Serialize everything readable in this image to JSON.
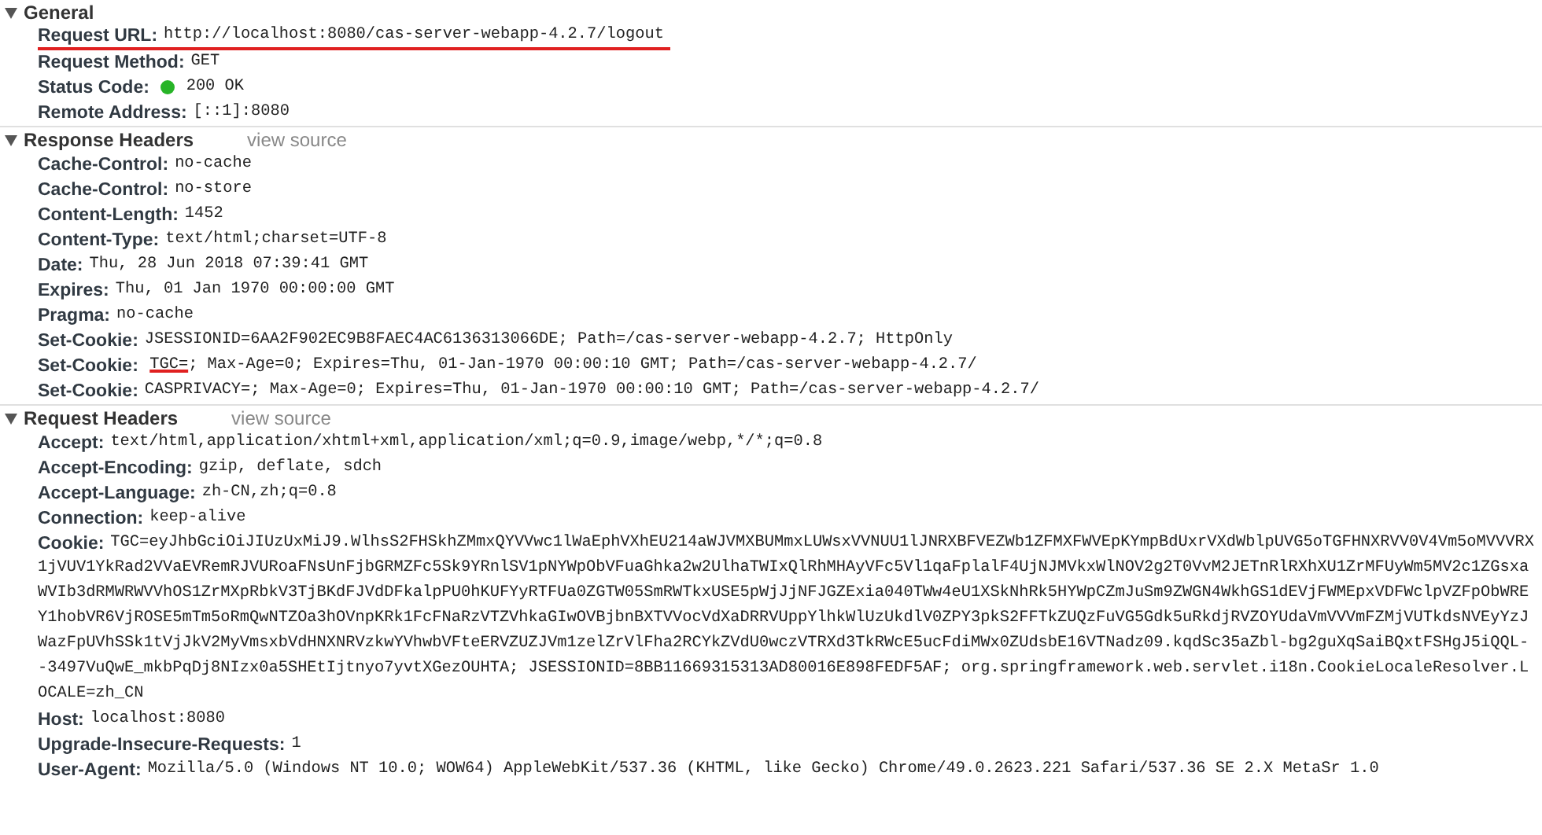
{
  "sections": [
    {
      "title": "General",
      "expanded": true,
      "rows": [
        {
          "key": "Request URL:",
          "value": "http://localhost:8080/cas-server-webapp-4.2.7/logout",
          "underlined": true
        },
        {
          "key": "Request Method:",
          "value": "GET",
          "underlined": false
        },
        {
          "key": "Status Code:",
          "value": "200 OK",
          "color": "#27b427",
          "underlined": false
        },
        {
          "key": "Remote Address:",
          "value": "[::1]:8080",
          "underlined": false
        }
      ]
    },
    {
      "title": "Response Headers",
      "view_source": "view source",
      "expanded": true,
      "rows": [
        {
          "key": "Cache-Control:",
          "value": "no-cache",
          "underlined": false
        },
        {
          "key": "Cache-Control:",
          "value": "no-store",
          "underlined": false
        },
        {
          "key": "Content-Length:",
          "value": "1452",
          "underlined": false
        },
        {
          "key": "Content-Type:",
          "value": "text/html;charset=UTF-8",
          "underlined": false
        },
        {
          "key": "Date:",
          "value": "Thu, 28 Jun 2018 07:39:41 GMT",
          "underlined": false
        },
        {
          "key": "Expires:",
          "value": "Thu, 01 Jan 1970 00:00:00 GMT",
          "underlined": false
        },
        {
          "key": "Pragma:",
          "value": "no-cache",
          "underlined": false
        },
        {
          "key": "Set-Cookie:",
          "value": "JSESSIONID=6AA2F902EC9B8FAEC4AC6136313066DE; Path=/cas-server-webapp-4.2.7; HttpOnly",
          "underlined": false
        },
        {
          "key": "Set-Cookie:",
          "value_parts": [
            {
              "text": "TGC=",
              "underlined": true
            },
            {
              "text": "; Max-Age=0; Expires=Thu, 01-Jan-1970 00:00:10 GMT; Path=/cas-server-webapp-4.2.7/",
              "underlined": false
            }
          ],
          "underlined": false
        },
        {
          "key": "Set-Cookie:",
          "value": "CASPRIVACY=; Max-Age=0; Expires=Thu, 01-Jan-1970 00:00:10 GMT; Path=/cas-server-webapp-4.2.7/",
          "underlined": false
        }
      ]
    },
    {
      "title": "Request Headers",
      "view_source": "view source",
      "expanded": true,
      "rows": [
        {
          "key": "Accept:",
          "value": "text/html,application/xhtml+xml,application/xml;q=0.9,image/webp,*/*;q=0.8",
          "underlined": false
        },
        {
          "key": "Accept-Encoding:",
          "value": "gzip, deflate, sdch",
          "underlined": false
        },
        {
          "key": "Accept-Language:",
          "value": "zh-CN,zh;q=0.8",
          "underlined": false
        },
        {
          "key": "Connection:",
          "value": "keep-alive",
          "underlined": false
        },
        {
          "key": "Cookie:",
          "value": "TGC=eyJhbGciOiJIUzUxMiJ9.WlhsS2FHSkhZMmxQYVVwc1lWaEphVXhEU214aWJVMXBUMmxLUWsxVVNUU1lJNRXBFVEZWb1ZFMXFWVEpKYmpBdUxrVXdWblpUVG5oTGFHNXRVV0V4Vm5oMVVVRX1jVUV1YkRad2VVaEVRemRJVURoaFNsUnFjbGRMZFc5Sk9YRnlSV1pNYWpObVFuaGhka2w2UlhaTWIxQlRhMHAyVFc5Vl1qaFplalF4UjNJMVkxWlNOV2g2T0VvM2JETnRlRXhXU1ZrMFUyWm5MV2c1ZGsxaWVIb3dRMWRWVVhOS1ZrMXpRbkV3TjBKdFJVdDFkalpPU0hKUFYyRTFUa0ZGTW05SmRWTkxUSE5pWjJjNFJGZExia040TWw4eU1XSkNhRk5HYWpCZmJuSm9ZWGN4WkhGS1dEVjFWMEpxVDFWclpVZFpObWREY1hobVR6VjROSE5mTm5oRmQwNTZOa3hOVnpKRk1FcFNaRzVTZVhkaGIwOVBjbnBXTVVocVdXaDRRVUppYlhkWlUzUkdlV0ZPY3pkS2FFTkZUQzFuVG5Gdk5uRkdjRVZOYUdaVmVVVmFZMjVUTkdsNVEyYzJWazFpUVhSSk1tVjJkV2MyVmsxbVdHNXNRVzkwYVhwbVFteERVZUZJVm1zelZrVlFha2RCYkZVdU0wczVTRXd3TkRWcE5ucFdiMWx0ZUdsbE16VTNadz09.kqdSc35aZbl-bg2guXqSaiBQxtFSHgJ5iQQL--3497VuQwE_mkbPqDj8NIzx0a5SHEtIjtnyo7yvtXGezOUHTA; JSESSIONID=8BB11669315313AD80016E898FEDF5AF; org.springframework.web.servlet.i18n.CookieLocaleResolver.LOCALE=zh_CN",
          "underlined": false
        },
        {
          "key": "Host:",
          "value": "localhost:8080",
          "underlined": false
        },
        {
          "key": "Upgrade-Insecure-Requests:",
          "value": "1",
          "underlined": false
        },
        {
          "key": "User-Agent:",
          "value": "Mozilla/5.0 (Windows NT 10.0; WOW64) AppleWebKit/537.36 (KHTML, like Gecko) Chrome/49.0.2623.221 Safari/537.36 SE 2.X MetaSr 1.0",
          "underlined": false
        }
      ]
    }
  ]
}
